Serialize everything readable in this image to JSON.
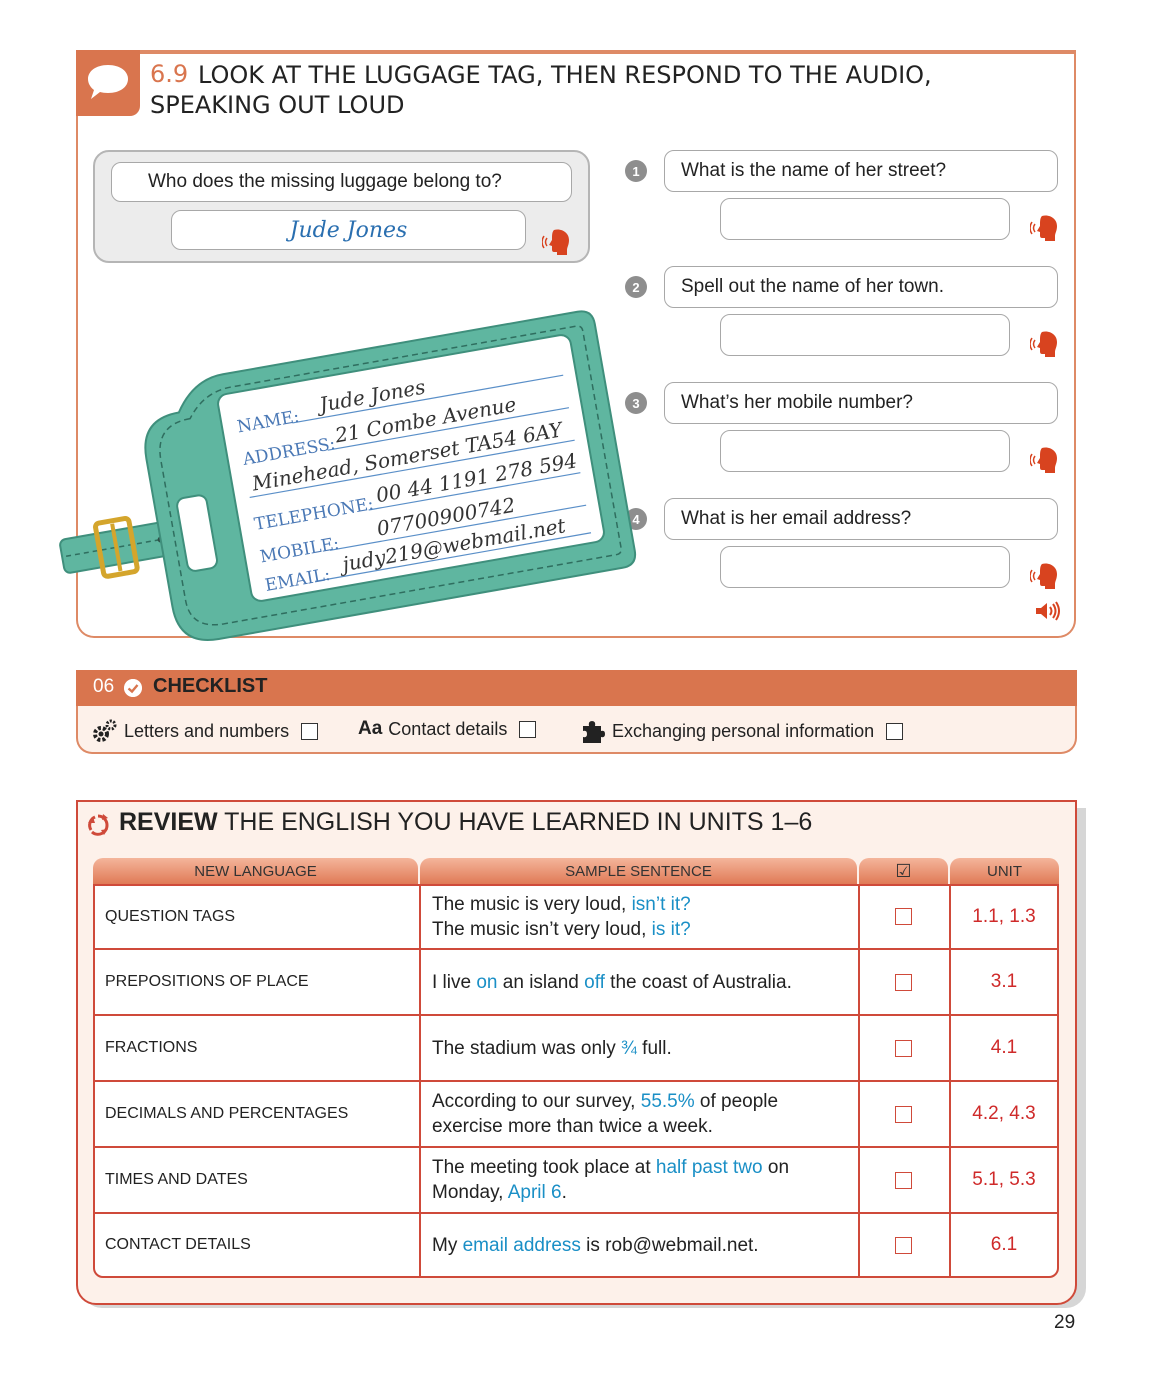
{
  "exercise": {
    "number": "6.9",
    "title_line1": "LOOK AT THE LUGGAGE TAG, THEN RESPOND TO THE AUDIO,",
    "title_line2": "SPEAKING OUT LOUD",
    "icon": "speech-bubble-icon",
    "example": {
      "question": "Who does the missing luggage belong to?",
      "answer": "Jude Jones"
    },
    "questions": [
      {
        "num": "1",
        "text": "What is the name of her street?"
      },
      {
        "num": "2",
        "text": "Spell out the name of her town."
      },
      {
        "num": "3",
        "text": "What’s her mobile number?"
      },
      {
        "num": "4",
        "text": "What is her email address?"
      }
    ],
    "tag": {
      "name_label": "NAME:",
      "name_value": "Jude Jones",
      "address_label": "ADDRESS:",
      "address_line1": "21 Combe Avenue",
      "address_line2": "Minehead, Somerset TA54 6AY",
      "telephone_label": "TELEPHONE:",
      "telephone_value": "00 44 1191 278 594",
      "mobile_label": "MOBILE:",
      "mobile_value": "07700900742",
      "email_label": "EMAIL:",
      "email_value": "judy219@webmail.net"
    }
  },
  "checklist": {
    "number": "06",
    "title": "CHECKLIST",
    "items": [
      {
        "icon": "gears-icon",
        "label": "Letters and numbers"
      },
      {
        "icon_text": "Aa",
        "label": "Contact details"
      },
      {
        "icon": "puzzle-icon",
        "label": "Exchanging personal information"
      }
    ]
  },
  "review": {
    "title_bold": "REVIEW",
    "title_rest": "THE ENGLISH YOU HAVE LEARNED IN UNITS 1–6",
    "headers": {
      "language": "NEW LANGUAGE",
      "sentence": "SAMPLE SENTENCE",
      "check": "☑",
      "unit": "UNIT"
    },
    "rows": [
      {
        "language": "QUESTION TAGS",
        "s1": "The music is very loud, ",
        "h1": "isn’t it?",
        "s2": "The music isn’t very loud, ",
        "h2": "is it?",
        "unit": "1.1, 1.3"
      },
      {
        "language": "PREPOSITIONS OF PLACE",
        "s1": "I live ",
        "h1": "on",
        "s2": " an island ",
        "h2": "off",
        "s3": " the coast of Australia.",
        "unit": "3.1"
      },
      {
        "language": "FRACTIONS",
        "s1": "The stadium was only ",
        "h1": "¾",
        "s2": " full.",
        "unit": "4.1"
      },
      {
        "language": "DECIMALS AND PERCENTAGES",
        "s1": "According to our survey, ",
        "h1": "55.5%",
        "s2": " of people exercise more than twice a week.",
        "unit": "4.2, 4.3"
      },
      {
        "language": "TIMES AND DATES",
        "s1": "The meeting took place at ",
        "h1": "half past two",
        "s2": " on Monday, ",
        "h2": "April 6",
        "s3": ".",
        "unit": "5.1, 5.3"
      },
      {
        "language": "CONTACT DETAILS",
        "s1": "My ",
        "h1": "email address",
        "s2": " is rob@webmail.net.",
        "unit": "6.1"
      }
    ]
  },
  "page_number": "29",
  "colors": {
    "accent": "#d9754e",
    "review_red": "#cf4a3a",
    "highlight_blue": "#1a8fc6",
    "tag_green": "#5fb6a0"
  }
}
